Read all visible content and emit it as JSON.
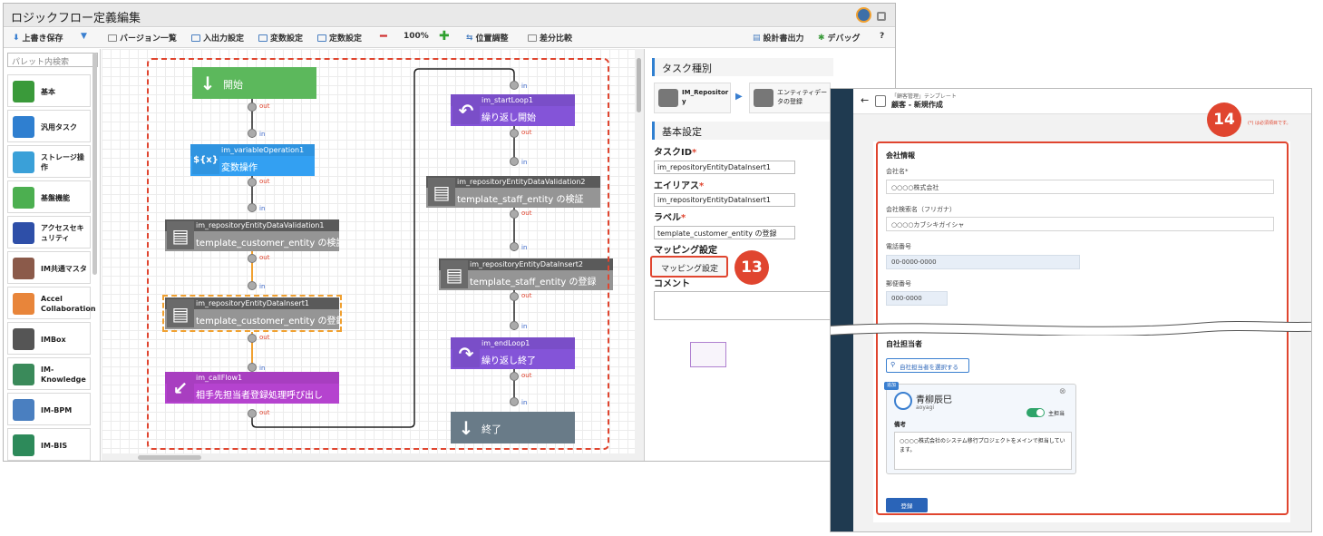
{
  "app": {
    "title": "ロジックフロー定義編集"
  },
  "toolbar": {
    "overwrite_save": "上書き保存",
    "version_list": "バージョン一覧",
    "io_settings": "入出力設定",
    "variable_settings": "変数設定",
    "constant_settings": "定数設定",
    "zoom": "100%",
    "position_adjust": "位置調整",
    "diff_compare": "差分比較",
    "design_doc_output": "設計書出力",
    "debug": "デバッグ",
    "help": "?"
  },
  "palette": {
    "search_placeholder": "パレット内検索",
    "items": [
      {
        "label": "基本",
        "color": "#3a9a3a"
      },
      {
        "label": "汎用タスク",
        "color": "#2f7fd0"
      },
      {
        "label": "ストレージ操作",
        "color": "#3aa0d8"
      },
      {
        "label": "基盤機能",
        "color": "#4caf50"
      },
      {
        "label": "アクセスセキュリティ",
        "color": "#2e4fa8"
      },
      {
        "label": "IM共通マスタ",
        "color": "#8b5a4a"
      },
      {
        "label": "Accel Collaboration",
        "color": "#e8853a"
      },
      {
        "label": "IMBox",
        "color": "#555555"
      },
      {
        "label": "IM-Knowledge",
        "color": "#3a8a5a"
      },
      {
        "label": "IM-BPM",
        "color": "#4a7fc0"
      },
      {
        "label": "IM-BIS",
        "color": "#2d8a5a"
      }
    ]
  },
  "flow": {
    "nodes": [
      {
        "id": "start",
        "header": "",
        "label": "開始",
        "color": "#5cb85c",
        "icon": "↓"
      },
      {
        "id": "var",
        "header": "im_variableOperation1",
        "label": "変数操作",
        "color": "#2f94e0",
        "icon": "${x}"
      },
      {
        "id": "val1",
        "header": "im_repositoryEntityDataValidation1",
        "label": "template_customer_entity の検証",
        "color": "#8a8a8a",
        "icon": "▤"
      },
      {
        "id": "ins1",
        "header": "im_repositoryEntityDataInsert1",
        "label": "template_customer_entity の登録",
        "color": "#8a8a8a",
        "icon": "▤"
      },
      {
        "id": "call",
        "header": "im_callFlow1",
        "label": "相手先担当者登録処理呼び出し",
        "color": "#a83ec0",
        "icon": "↙"
      },
      {
        "id": "loop1",
        "header": "im_startLoop1",
        "label": "繰り返し開始",
        "color": "#7a4ec8",
        "icon": "↶"
      },
      {
        "id": "val2",
        "header": "im_repositoryEntityDataValidation2",
        "label": "template_staff_entity の検証",
        "color": "#8a8a8a",
        "icon": "▤"
      },
      {
        "id": "ins2",
        "header": "im_repositoryEntityDataInsert2",
        "label": "template_staff_entity の登録",
        "color": "#8a8a8a",
        "icon": "▤"
      },
      {
        "id": "loop2",
        "header": "im_endLoop1",
        "label": "繰り返し終了",
        "color": "#7a4ec8",
        "icon": "↷"
      },
      {
        "id": "end",
        "header": "",
        "label": "終了",
        "color": "#697b88",
        "icon": "↓"
      }
    ],
    "port_out": "out",
    "port_in": "in"
  },
  "properties": {
    "task_type_heading": "タスク種別",
    "task_type_from": "IM_Repository",
    "task_type_to": "エンティティデータの登録",
    "basic_heading": "基本設定",
    "task_id_label": "タスクID",
    "task_id_value": "im_repositoryEntityDataInsert1",
    "alias_label": "エイリアス",
    "alias_value": "im_repositoryEntityDataInsert1",
    "label_label": "ラベル",
    "label_value": "template_customer_entity の登録",
    "mapping_heading": "マッピング設定",
    "mapping_button": "マッピング設定",
    "comment_label": "コメント"
  },
  "callouts": {
    "a": "13",
    "b": "14"
  },
  "form": {
    "breadcrumb": "「顧客管理」テンプレート",
    "title": "顧客 - 新規作成",
    "required_note": "(*) は必須項目です。",
    "company_section": "会社情報",
    "company_name_label": "会社名*",
    "company_name_value": "○○○○株式会社",
    "company_kana_label": "会社検索名（フリガナ）",
    "company_kana_value": "○○○○カブシキガイシャ",
    "phone_label": "電話番号",
    "phone_value": "00-0000-0000",
    "zip_label": "郵便番号",
    "zip_value": "000-0000",
    "staff_section": "自社担当者",
    "select_staff_button": "自社担当者を選択する",
    "staff_tag": "追加",
    "staff_name": "青柳辰巳",
    "staff_id": "aoyagi",
    "main_staff_label": "主担当",
    "note_label": "備考",
    "note_value": "○○○○株式会社のシステム移行プロジェクトをメインで担当しています。",
    "register_button": "登録"
  }
}
